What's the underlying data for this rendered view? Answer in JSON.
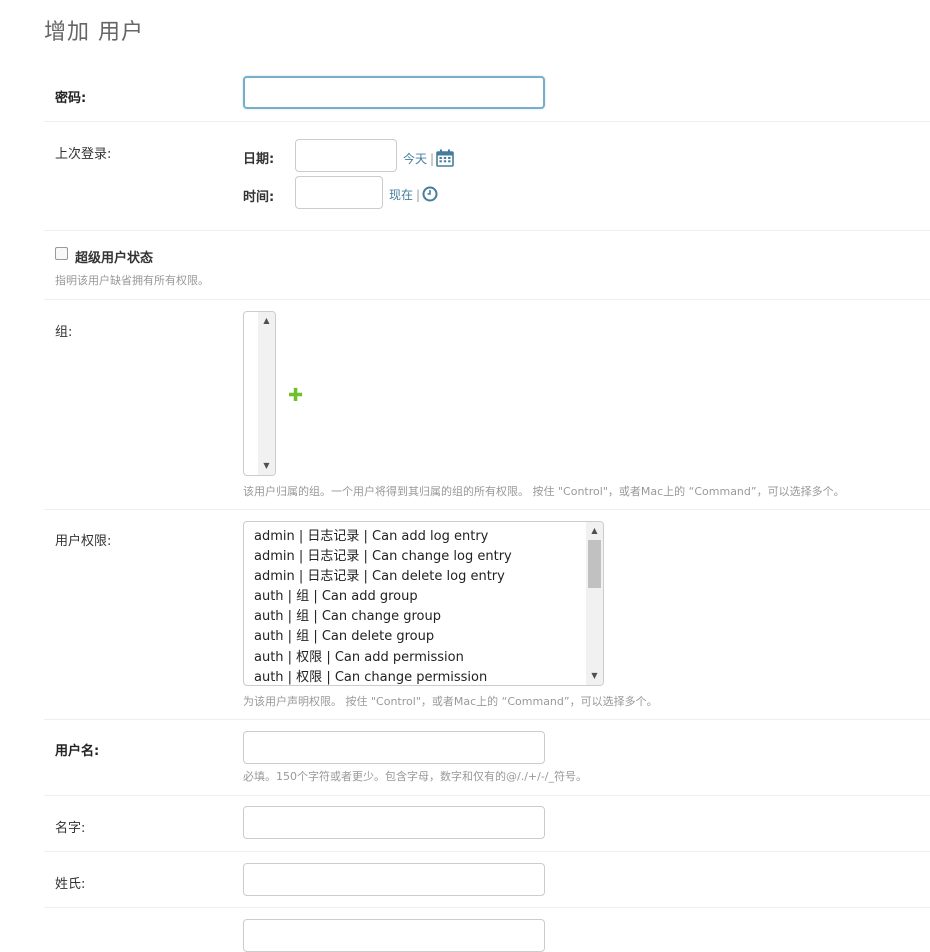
{
  "page": {
    "title": "增加 用户"
  },
  "password": {
    "label": "密码:",
    "value": ""
  },
  "last_login": {
    "label": "上次登录:",
    "date_label": "日期:",
    "date_value": "",
    "today_link": "今天",
    "time_label": "时间:",
    "time_value": "",
    "now_link": "现在",
    "separator": "|"
  },
  "superuser": {
    "label": "超级用户状态",
    "checked": false,
    "help": "指明该用户缺省拥有所有权限。"
  },
  "groups": {
    "label": "组:",
    "options": [],
    "help": "该用户归属的组。一个用户将得到其归属的组的所有权限。 按住 \"Control\"，或者Mac上的 “Command”，可以选择多个。",
    "add_icon": "plus-icon"
  },
  "permissions": {
    "label": "用户权限:",
    "options": [
      "admin | 日志记录 | Can add log entry",
      "admin | 日志记录 | Can change log entry",
      "admin | 日志记录 | Can delete log entry",
      "auth | 组 | Can add group",
      "auth | 组 | Can change group",
      "auth | 组 | Can delete group",
      "auth | 权限 | Can add permission",
      "auth | 权限 | Can change permission"
    ],
    "help": "为该用户声明权限。 按住 \"Control\"，或者Mac上的 “Command”，可以选择多个。"
  },
  "username": {
    "label": "用户名:",
    "value": "",
    "help": "必填。150个字符或者更少。包含字母，数字和仅有的@/./+/-/_符号。"
  },
  "first_name": {
    "label": "名字:",
    "value": ""
  },
  "last_name": {
    "label": "姓氏:",
    "value": ""
  },
  "colors": {
    "link": "#447e9b",
    "focus_border": "#79aec8",
    "add_green": "#70bf2b",
    "help_text": "#999999"
  }
}
